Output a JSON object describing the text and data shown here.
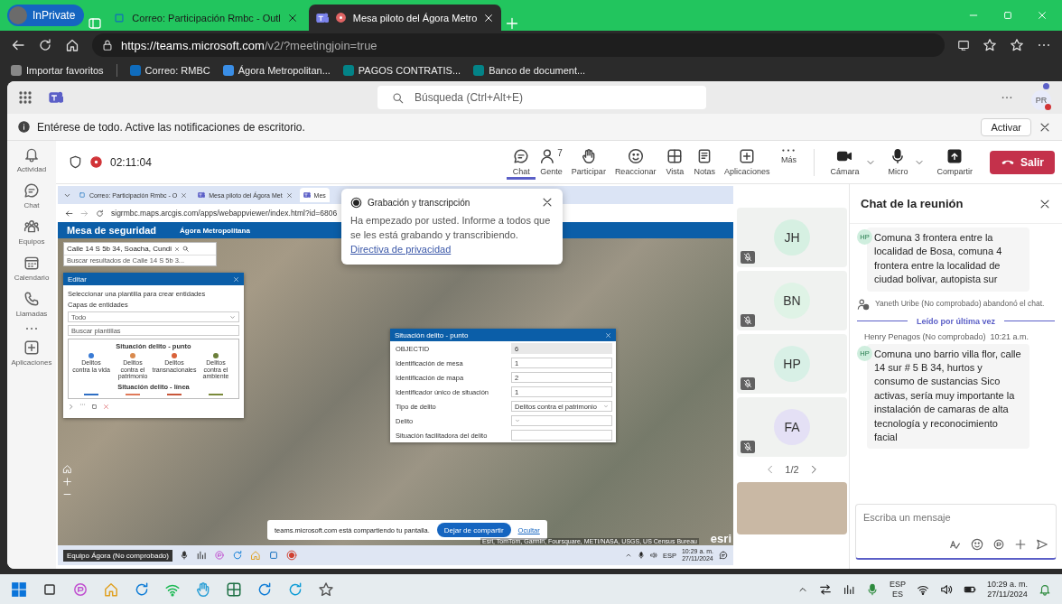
{
  "browser": {
    "profile": "InPrivate",
    "tabs": [
      {
        "title": "Correo: Participación Rmbc - Outl",
        "selected": false
      },
      {
        "title": "Mesa piloto del Ágora Metro",
        "selected": true
      }
    ],
    "url_host": "https://teams.microsoft.com",
    "url_path": "/v2/?meetingjoin=true",
    "favorites": [
      "Importar favoritos",
      "Correo: RMBC",
      "Ágora Metropolitan...",
      "PAGOS CONTRATIS...",
      "Banco de document..."
    ]
  },
  "teams": {
    "search_placeholder": "Búsqueda (Ctrl+Alt+E)",
    "avatar": "PR"
  },
  "notification": {
    "text": "Entérese de todo. Active las notificaciones de escritorio.",
    "button": "Activar"
  },
  "rail": [
    {
      "label": "Actividad"
    },
    {
      "label": "Chat"
    },
    {
      "label": "Equipos"
    },
    {
      "label": "Calendario"
    },
    {
      "label": "Llamadas"
    },
    {
      "kind": "more"
    },
    {
      "label": "Aplicaciones"
    }
  ],
  "meeting_toolbar": {
    "timer": "02:11:04",
    "recording": true,
    "actions": [
      {
        "label": "Chat",
        "selected": true
      },
      {
        "label": "Gente",
        "count": "7",
        "selected": false
      },
      {
        "label": "Participar",
        "selected": false
      },
      {
        "label": "Reaccionar",
        "selected": false
      },
      {
        "label": "Vista",
        "selected": false
      },
      {
        "label": "Notas",
        "selected": false
      },
      {
        "label": "Aplicaciones",
        "selected": false
      },
      {
        "label": "Más",
        "selected": false
      }
    ],
    "devices": [
      {
        "label": "Cámara",
        "dropdown": true
      },
      {
        "label": "Micro",
        "dropdown": true
      },
      {
        "label": "Compartir",
        "dropdown": false
      }
    ],
    "leave": "Salir"
  },
  "shared_screen": {
    "tabs": [
      {
        "title": "Correo: Participación Rmbc - O",
        "selected": false
      },
      {
        "title": "Mesa piloto del Ágora Met",
        "selected": false
      },
      {
        "title": "Mes",
        "selected": true
      }
    ],
    "url": "sigrmbc.maps.arcgis.com/apps/webappviewer/index.html?id=6806",
    "app_title": "Mesa de seguridad",
    "app_subtitle": "Ágora Metropolitana",
    "search_value": "Calle 14 S 5b 34, Soacha, Cundi",
    "search_suggestion": "Buscar resultados de Calle 14 S 5b 3...",
    "edit_panel": {
      "title": "Editar",
      "instruction": "Seleccionar una plantilla para crear entidades",
      "layers_label": "Capas de entidades",
      "layers_value": "Todo",
      "search_placeholder": "Buscar plantillas",
      "groups": [
        {
          "title": "Situación delito - punto",
          "kind": "point",
          "items": [
            {
              "label": "Delitos contra la vida",
              "color": "#3a7bd5"
            },
            {
              "label": "Delitos contra el patrimonio",
              "color": "#d98a4e"
            },
            {
              "label": "Delitos transnacionales",
              "color": "#d9623a"
            },
            {
              "label": "Delitos contra el ambiente",
              "color": "#6b7f3a"
            }
          ]
        },
        {
          "title": "Situación delito - línea",
          "kind": "line",
          "items": [
            {
              "color": "#2f6fc4"
            },
            {
              "color": "#e07a5a"
            },
            {
              "color": "#c8573a"
            },
            {
              "color": "#7a8a3a"
            }
          ]
        }
      ]
    },
    "feature_panel": {
      "title": "Situación delito - punto",
      "fields": [
        {
          "label": "OBJECTID",
          "value": "6",
          "disabled": true,
          "kind": "text"
        },
        {
          "label": "Identificación de mesa",
          "value": "1",
          "disabled": false,
          "kind": "text"
        },
        {
          "label": "Identificación de mapa",
          "value": "2",
          "disabled": false,
          "kind": "text"
        },
        {
          "label": "Identificador único de situación",
          "value": "1",
          "disabled": false,
          "kind": "text"
        },
        {
          "label": "Tipo de delito",
          "value": "Delitos contra el patrimonio",
          "disabled": false,
          "kind": "select"
        },
        {
          "label": "Delito",
          "disabled": false,
          "kind": "select"
        },
        {
          "label": "Situación facilitadora del delito",
          "disabled": false,
          "kind": "text"
        }
      ]
    },
    "share_bar": {
      "text": "teams.microsoft.com está compartiendo tu pantalla.",
      "stop": "Dejar de compartir",
      "hide": "Ocultar"
    },
    "attribution": "Esri, TomTom, Garmin, Foursquare, METI/NASA, USGS, US Census Bureau",
    "logo": "esri",
    "taskbar": {
      "presenter": "Equipo Ágora (No comprobado)",
      "lang": "ESP",
      "time": "10:29 a. m.",
      "date": "27/11/2024"
    }
  },
  "recording_popup": {
    "title": "Grabación y transcripción",
    "text": "Ha empezado por usted. Informe a todos que se les está grabando y transcribiendo.",
    "link": "Directiva de privacidad"
  },
  "participants": [
    {
      "initials": "JH",
      "muted": true,
      "color": "#d6f0e2"
    },
    {
      "initials": "BN",
      "muted": true,
      "color": "#dff3e6"
    },
    {
      "initials": "HP",
      "muted": true,
      "color": "#d8f0e6"
    },
    {
      "initials": "FA",
      "muted": true,
      "color": "#e4e0f5"
    }
  ],
  "pager": "1/2",
  "chat": {
    "title": "Chat de la reunión",
    "messages": [
      {
        "kind": "message",
        "initials": "HP",
        "text": "Comuna 3 frontera entre la localidad de Bosa, comuna 4 frontera entre la localidad de ciudad bolivar, autopista sur"
      },
      {
        "kind": "event",
        "text": "Yaneth Uribe (No comprobado) abandonó el chat."
      },
      {
        "kind": "divider",
        "text": "Leído por última vez"
      },
      {
        "kind": "message",
        "author": "Henry Penagos (No comprobado)",
        "time": "10:21 a.m.",
        "initials": "HP",
        "text": "Comuna uno barrio villa flor, calle 14 sur # 5 B 34,  hurtos y consumo de sustancias Sico activas,  sería muy importante la instalación de camaras de alta tecnología y reconocimiento facial"
      }
    ],
    "compose_placeholder": "Escriba un mensaje"
  },
  "taskbar": {
    "lang": "ESP",
    "layout": "ES",
    "time": "10:29 a. m.",
    "date": "27/11/2024"
  }
}
